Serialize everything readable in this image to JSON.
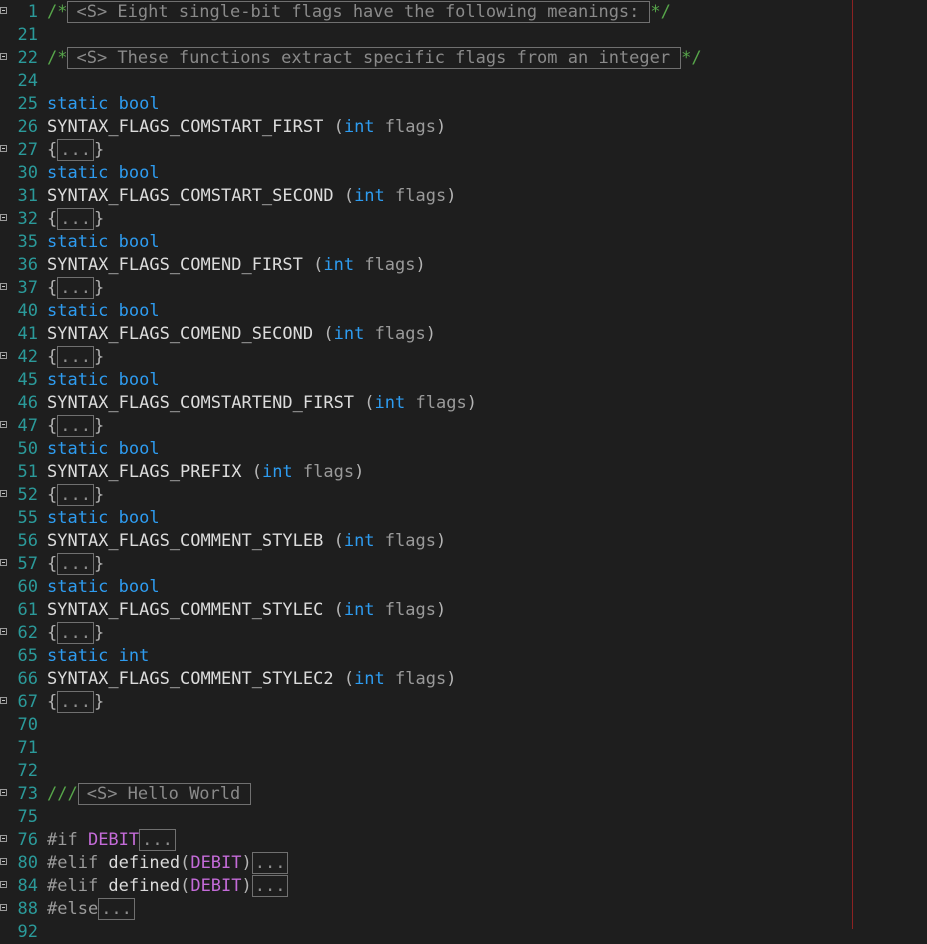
{
  "editor": {
    "lines": [
      {
        "num": "1",
        "fold": true,
        "parts": [
          [
            "c",
            "/*"
          ],
          [
            "cbox",
            "<S> Eight single-bit flags have the following meanings:"
          ],
          [
            "c",
            "*/"
          ]
        ]
      },
      {
        "num": "21",
        "fold": false,
        "parts": []
      },
      {
        "num": "22",
        "fold": true,
        "parts": [
          [
            "c",
            "/*"
          ],
          [
            "cbox",
            "<S> These functions extract specific flags from an integer"
          ],
          [
            "c",
            "*/"
          ]
        ]
      },
      {
        "num": "24",
        "fold": false,
        "parts": []
      },
      {
        "num": "25",
        "fold": false,
        "parts": [
          [
            "kw",
            "static"
          ],
          [
            "txt",
            " "
          ],
          [
            "kw",
            "bool"
          ]
        ]
      },
      {
        "num": "26",
        "fold": false,
        "parts": [
          [
            "txt",
            "SYNTAX_FLAGS_COMSTART_FIRST "
          ],
          [
            "pun",
            "("
          ],
          [
            "kw",
            "int"
          ],
          [
            "txt",
            " "
          ],
          [
            "param",
            "flags"
          ],
          [
            "pun",
            ")"
          ]
        ]
      },
      {
        "num": "27",
        "fold": true,
        "parts": [
          [
            "pun",
            "{"
          ],
          [
            "box",
            "..."
          ],
          [
            "pun",
            "}"
          ]
        ]
      },
      {
        "num": "30",
        "fold": false,
        "parts": [
          [
            "kw",
            "static"
          ],
          [
            "txt",
            " "
          ],
          [
            "kw",
            "bool"
          ]
        ]
      },
      {
        "num": "31",
        "fold": false,
        "parts": [
          [
            "txt",
            "SYNTAX_FLAGS_COMSTART_SECOND "
          ],
          [
            "pun",
            "("
          ],
          [
            "kw",
            "int"
          ],
          [
            "txt",
            " "
          ],
          [
            "param",
            "flags"
          ],
          [
            "pun",
            ")"
          ]
        ]
      },
      {
        "num": "32",
        "fold": true,
        "parts": [
          [
            "pun",
            "{"
          ],
          [
            "box",
            "..."
          ],
          [
            "pun",
            "}"
          ]
        ]
      },
      {
        "num": "35",
        "fold": false,
        "parts": [
          [
            "kw",
            "static"
          ],
          [
            "txt",
            " "
          ],
          [
            "kw",
            "bool"
          ]
        ]
      },
      {
        "num": "36",
        "fold": false,
        "parts": [
          [
            "txt",
            "SYNTAX_FLAGS_COMEND_FIRST "
          ],
          [
            "pun",
            "("
          ],
          [
            "kw",
            "int"
          ],
          [
            "txt",
            " "
          ],
          [
            "param",
            "flags"
          ],
          [
            "pun",
            ")"
          ]
        ]
      },
      {
        "num": "37",
        "fold": true,
        "parts": [
          [
            "pun",
            "{"
          ],
          [
            "box",
            "..."
          ],
          [
            "pun",
            "}"
          ]
        ]
      },
      {
        "num": "40",
        "fold": false,
        "parts": [
          [
            "kw",
            "static"
          ],
          [
            "txt",
            " "
          ],
          [
            "kw",
            "bool"
          ]
        ]
      },
      {
        "num": "41",
        "fold": false,
        "parts": [
          [
            "txt",
            "SYNTAX_FLAGS_COMEND_SECOND "
          ],
          [
            "pun",
            "("
          ],
          [
            "kw",
            "int"
          ],
          [
            "txt",
            " "
          ],
          [
            "param",
            "flags"
          ],
          [
            "pun",
            ")"
          ]
        ]
      },
      {
        "num": "42",
        "fold": true,
        "parts": [
          [
            "pun",
            "{"
          ],
          [
            "box",
            "..."
          ],
          [
            "pun",
            "}"
          ]
        ]
      },
      {
        "num": "45",
        "fold": false,
        "parts": [
          [
            "kw",
            "static"
          ],
          [
            "txt",
            " "
          ],
          [
            "kw",
            "bool"
          ]
        ]
      },
      {
        "num": "46",
        "fold": false,
        "parts": [
          [
            "txt",
            "SYNTAX_FLAGS_COMSTARTEND_FIRST "
          ],
          [
            "pun",
            "("
          ],
          [
            "kw",
            "int"
          ],
          [
            "txt",
            " "
          ],
          [
            "param",
            "flags"
          ],
          [
            "pun",
            ")"
          ]
        ]
      },
      {
        "num": "47",
        "fold": true,
        "parts": [
          [
            "pun",
            "{"
          ],
          [
            "box",
            "..."
          ],
          [
            "pun",
            "}"
          ]
        ]
      },
      {
        "num": "50",
        "fold": false,
        "parts": [
          [
            "kw",
            "static"
          ],
          [
            "txt",
            " "
          ],
          [
            "kw",
            "bool"
          ]
        ]
      },
      {
        "num": "51",
        "fold": false,
        "parts": [
          [
            "txt",
            "SYNTAX_FLAGS_PREFIX "
          ],
          [
            "pun",
            "("
          ],
          [
            "kw",
            "int"
          ],
          [
            "txt",
            " "
          ],
          [
            "param",
            "flags"
          ],
          [
            "pun",
            ")"
          ]
        ]
      },
      {
        "num": "52",
        "fold": true,
        "parts": [
          [
            "pun",
            "{"
          ],
          [
            "box",
            "..."
          ],
          [
            "pun",
            "}"
          ]
        ]
      },
      {
        "num": "55",
        "fold": false,
        "parts": [
          [
            "kw",
            "static"
          ],
          [
            "txt",
            " "
          ],
          [
            "kw",
            "bool"
          ]
        ]
      },
      {
        "num": "56",
        "fold": false,
        "parts": [
          [
            "txt",
            "SYNTAX_FLAGS_COMMENT_STYLEB "
          ],
          [
            "pun",
            "("
          ],
          [
            "kw",
            "int"
          ],
          [
            "txt",
            " "
          ],
          [
            "param",
            "flags"
          ],
          [
            "pun",
            ")"
          ]
        ]
      },
      {
        "num": "57",
        "fold": true,
        "parts": [
          [
            "pun",
            "{"
          ],
          [
            "box",
            "..."
          ],
          [
            "pun",
            "}"
          ]
        ]
      },
      {
        "num": "60",
        "fold": false,
        "parts": [
          [
            "kw",
            "static"
          ],
          [
            "txt",
            " "
          ],
          [
            "kw",
            "bool"
          ]
        ]
      },
      {
        "num": "61",
        "fold": false,
        "parts": [
          [
            "txt",
            "SYNTAX_FLAGS_COMMENT_STYLEC "
          ],
          [
            "pun",
            "("
          ],
          [
            "kw",
            "int"
          ],
          [
            "txt",
            " "
          ],
          [
            "param",
            "flags"
          ],
          [
            "pun",
            ")"
          ]
        ]
      },
      {
        "num": "62",
        "fold": true,
        "parts": [
          [
            "pun",
            "{"
          ],
          [
            "box",
            "..."
          ],
          [
            "pun",
            "}"
          ]
        ]
      },
      {
        "num": "65",
        "fold": false,
        "parts": [
          [
            "kw",
            "static"
          ],
          [
            "txt",
            " "
          ],
          [
            "kw",
            "int"
          ]
        ]
      },
      {
        "num": "66",
        "fold": false,
        "parts": [
          [
            "txt",
            "SYNTAX_FLAGS_COMMENT_STYLEC2 "
          ],
          [
            "pun",
            "("
          ],
          [
            "kw",
            "int"
          ],
          [
            "txt",
            " "
          ],
          [
            "param",
            "flags"
          ],
          [
            "pun",
            ")"
          ]
        ]
      },
      {
        "num": "67",
        "fold": true,
        "parts": [
          [
            "pun",
            "{"
          ],
          [
            "box",
            "..."
          ],
          [
            "pun",
            "}"
          ]
        ]
      },
      {
        "num": "70",
        "fold": false,
        "parts": []
      },
      {
        "num": "71",
        "fold": false,
        "parts": []
      },
      {
        "num": "72",
        "fold": false,
        "parts": []
      },
      {
        "num": "73",
        "fold": true,
        "parts": [
          [
            "c",
            "///"
          ],
          [
            "cbox",
            "<S> Hello World"
          ]
        ]
      },
      {
        "num": "75",
        "fold": false,
        "parts": []
      },
      {
        "num": "76",
        "fold": true,
        "parts": [
          [
            "pp",
            "#if "
          ],
          [
            "mac",
            "DEBIT"
          ],
          [
            "box",
            "..."
          ]
        ]
      },
      {
        "num": "80",
        "fold": true,
        "parts": [
          [
            "pp",
            "#elif "
          ],
          [
            "txt",
            "defined"
          ],
          [
            "pun",
            "("
          ],
          [
            "mac",
            "DEBIT"
          ],
          [
            "pun",
            ")"
          ],
          [
            "box",
            "..."
          ]
        ]
      },
      {
        "num": "84",
        "fold": true,
        "parts": [
          [
            "pp",
            "#elif "
          ],
          [
            "txt",
            "defined"
          ],
          [
            "pun",
            "("
          ],
          [
            "mac",
            "DEBIT"
          ],
          [
            "pun",
            ")"
          ],
          [
            "box",
            "..."
          ]
        ]
      },
      {
        "num": "88",
        "fold": true,
        "parts": [
          [
            "pp",
            "#else"
          ],
          [
            "box",
            "..."
          ]
        ]
      },
      {
        "num": "92",
        "fold": false,
        "parts": []
      }
    ]
  },
  "colors": {
    "background": "#1e1e1e",
    "line_number": "#2b9a9a",
    "keyword": "#2e9cf0",
    "comment": "#57a64a",
    "macro": "#c46bd8",
    "guide_line": "#8b2222"
  }
}
